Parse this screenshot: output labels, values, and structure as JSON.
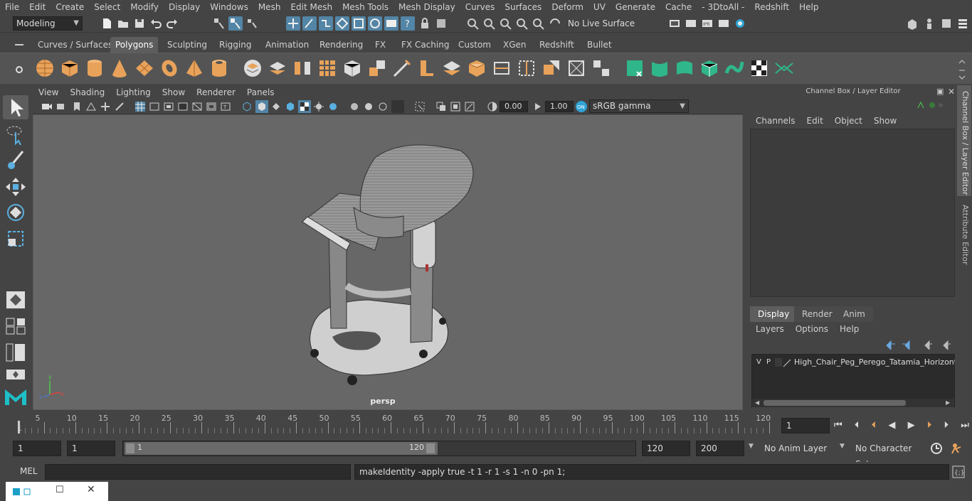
{
  "menubar": [
    "File",
    "Edit",
    "Create",
    "Select",
    "Modify",
    "Display",
    "Windows",
    "Mesh",
    "Edit Mesh",
    "Mesh Tools",
    "Mesh Display",
    "Curves",
    "Surfaces",
    "Deform",
    "UV",
    "Generate",
    "Cache",
    "- 3DtoAll -",
    "Redshift",
    "Help"
  ],
  "status": {
    "mode": "Modeling",
    "live_surface": "No Live Surface"
  },
  "shelf_tabs": [
    "Curves / Surfaces",
    "Polygons",
    "Sculpting",
    "Rigging",
    "Animation",
    "Rendering",
    "FX",
    "FX Caching",
    "Custom",
    "XGen",
    "Redshift",
    "Bullet"
  ],
  "active_shelf_tab": "Polygons",
  "viewport": {
    "menu": [
      "View",
      "Shading",
      "Lighting",
      "Show",
      "Renderer",
      "Panels"
    ],
    "exposure": "0.00",
    "gamma": "1.00",
    "color_space": "sRGB gamma",
    "camera_label": "persp"
  },
  "channel_box": {
    "title": "Channel Box / Layer Editor",
    "menu": [
      "Channels",
      "Edit",
      "Object",
      "Show"
    ]
  },
  "layer_editor": {
    "tabs": [
      "Display",
      "Render",
      "Anim"
    ],
    "active_tab": "Display",
    "menu": [
      "Layers",
      "Options",
      "Help"
    ],
    "layer": {
      "v": "V",
      "p": "P",
      "name": "High_Chair_Peg_Perego_Tatamia_Horizonta"
    }
  },
  "side_tabs": {
    "channel": "Channel Box / Layer Editor",
    "attribute": "Attribute Editor"
  },
  "timeline": {
    "ticks": [
      5,
      10,
      15,
      20,
      25,
      30,
      35,
      40,
      45,
      50,
      55,
      60,
      65,
      70,
      75,
      80,
      85,
      90,
      95,
      100,
      105,
      110,
      115,
      120
    ],
    "first_tick": "1",
    "current_frame": "1"
  },
  "range": {
    "start": "1",
    "playback_start": "1",
    "slider_start": "1",
    "slider_end": "120",
    "playback_end": "120",
    "end": "200",
    "anim_layer": "No Anim Layer",
    "char_set": "No Character Set"
  },
  "command": {
    "lang": "MEL",
    "result": "makeIdentity -apply true -t 1 -r 1 -s 1 -n 0 -pn 1;"
  },
  "colors": {
    "accent": "#5285a6",
    "mesh": "#c8c8c8",
    "shelf_icon": "#e8a25a",
    "green_icon": "#2fb68a",
    "viewport_bg": "#676767"
  }
}
